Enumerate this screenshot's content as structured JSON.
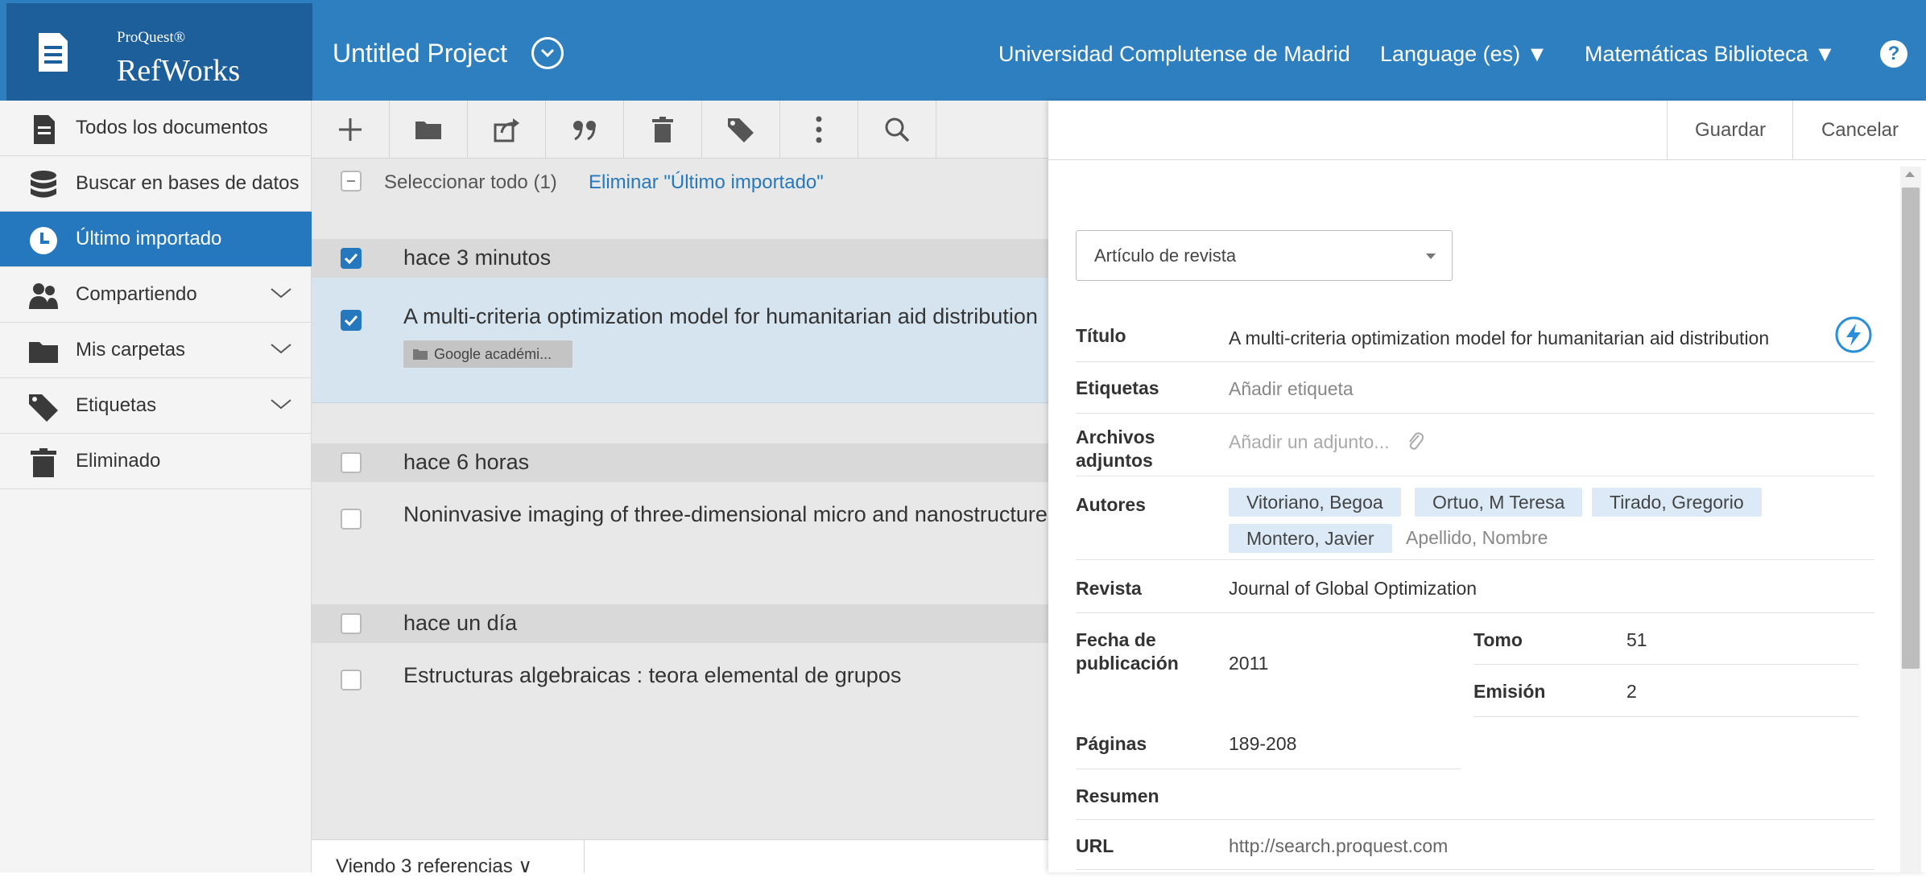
{
  "header": {
    "logo_small": "ProQuest®",
    "logo_big": "RefWorks",
    "project_title": "Untitled Project",
    "university": "Universidad Complutense de Madrid",
    "language": "Language (es) ▼",
    "library": "Matemáticas Biblioteca ▼",
    "help": "?",
    "color": "#2e7fc0"
  },
  "sidebar": {
    "items": [
      {
        "label": "Todos los documentos",
        "icon": "document-icon"
      },
      {
        "label": "Buscar en bases de datos",
        "icon": "database-icon"
      },
      {
        "label": "Último importado",
        "icon": "clock-icon",
        "active": true
      },
      {
        "label": "Compartiendo",
        "icon": "people-icon"
      },
      {
        "label": "Mis carpetas",
        "icon": "folder-icon"
      },
      {
        "label": "Etiquetas",
        "icon": "tag-icon"
      },
      {
        "label": "Eliminado",
        "icon": "trash-icon"
      }
    ]
  },
  "toolbar": {
    "buttons": [
      "add-icon",
      "folder-icon",
      "share-icon",
      "quote-icon",
      "trash-icon",
      "tag-icon",
      "more-icon",
      "search-icon"
    ]
  },
  "list": {
    "select_all": "Seleccionar todo (1)",
    "remove_last": "Eliminar \"Último importado\"",
    "groups": [
      {
        "header": "hace 3 minutos",
        "checked": true,
        "ref_title": "A multi-criteria optimization model for humanitarian aid distribution",
        "ref_tag": "Google académi..."
      },
      {
        "header": "hace 6 horas",
        "checked": false,
        "ref_title": "Noninvasive imaging of three-dimensional micro and nanostructures"
      },
      {
        "header": "hace un día",
        "checked": false,
        "ref_title": "Estructuras algebraicas : teora elemental de grupos"
      }
    ],
    "footer": "Viendo 3 referencias ∨"
  },
  "panel": {
    "save": "Guardar",
    "cancel": "Cancelar",
    "ref_type": "Artículo de revista",
    "labels": {
      "title": "Título",
      "tags": "Etiquetas",
      "attachments": "Archivos adjuntos",
      "authors": "Autores",
      "journal": "Revista",
      "pubdate": "Fecha de publicación",
      "volume": "Tomo",
      "issue": "Emisión",
      "pages": "Páginas",
      "abstract": "Resumen",
      "url": "URL"
    },
    "values": {
      "title": "A multi-criteria optimization model for humanitarian aid distribution",
      "tags_placeholder": "Añadir etiqueta",
      "attachments_placeholder": "Añadir un adjunto...",
      "authors": [
        "Vitoriano, Begoa",
        "Ortuo, M Teresa",
        "Tirado, Gregorio",
        "Montero, Javier"
      ],
      "author_placeholder": "Apellido, Nombre",
      "journal": "Journal of Global Optimization",
      "pubdate": "2011",
      "volume": "51",
      "issue": "2",
      "pages": "189-208",
      "abstract": "",
      "url": "http://search.proquest.com"
    }
  }
}
